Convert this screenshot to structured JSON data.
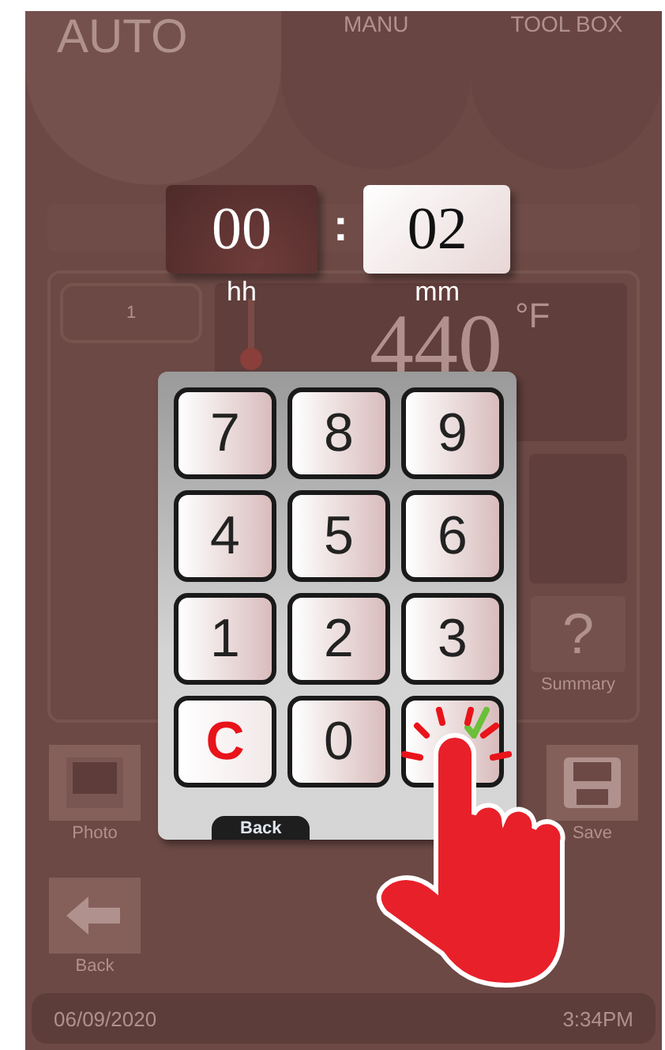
{
  "tabs": [
    {
      "label": "AUTO",
      "selected": true
    },
    {
      "label": "MANU",
      "selected": false
    },
    {
      "label": "TOOL BOX",
      "selected": false
    }
  ],
  "panel": {
    "slot": "1",
    "temperature": "440",
    "unit": "°F",
    "help": "?",
    "summary": "Summary"
  },
  "actions": [
    {
      "label": "Photo",
      "kind": "photo"
    },
    {
      "label": "Save",
      "kind": "save"
    },
    {
      "label": "Back",
      "kind": "back"
    }
  ],
  "status_bar": {
    "date": "06/09/2020",
    "time": "3:34PM"
  },
  "time_entry": {
    "separator": ":",
    "fields": [
      {
        "value": "00",
        "unit": "hh",
        "selected": true
      },
      {
        "value": "02",
        "unit": "mm",
        "selected": false
      }
    ]
  },
  "keypad": {
    "keys": [
      {
        "label": "7",
        "kind": "digit"
      },
      {
        "label": "8",
        "kind": "digit"
      },
      {
        "label": "9",
        "kind": "digit"
      },
      {
        "label": "4",
        "kind": "digit"
      },
      {
        "label": "5",
        "kind": "digit"
      },
      {
        "label": "6",
        "kind": "digit"
      },
      {
        "label": "1",
        "kind": "digit"
      },
      {
        "label": "2",
        "kind": "digit"
      },
      {
        "label": "3",
        "kind": "digit"
      },
      {
        "label": "C",
        "kind": "clear"
      },
      {
        "label": "0",
        "kind": "digit"
      },
      {
        "kind": "confirm"
      }
    ],
    "back": "Back"
  }
}
